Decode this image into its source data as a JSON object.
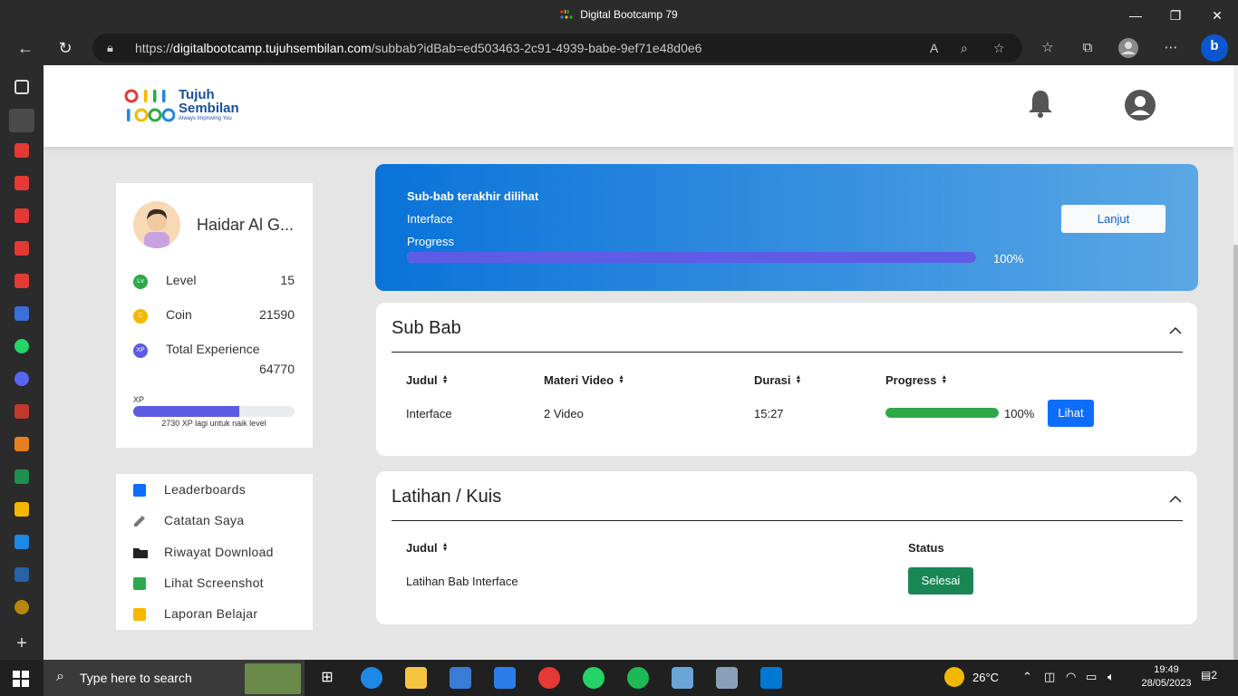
{
  "browser": {
    "window_title": "Digital Bootcamp 79",
    "url_prefix": "https://",
    "url_host": "digitalbootcamp.tujuhsembilan.com",
    "url_path": "/subbab?idBab=ed503463-2c91-4939-babe-9ef71e48d0e6"
  },
  "site": {
    "logo_word1": "Tujuh",
    "logo_word2": "Sembilan",
    "logo_tagline": "Always Improving You"
  },
  "profile": {
    "name": "Haidar Al G...",
    "stats": [
      {
        "badge": "Lv",
        "label": "Level",
        "value": "15",
        "color": "#2ea94a"
      },
      {
        "badge": "C",
        "label": "Coin",
        "value": "21590",
        "color": "#f5b800"
      },
      {
        "badge": "XP",
        "label": "Total Experience",
        "value": "64770",
        "color": "#5b5ce2"
      }
    ],
    "xp_label": "XP",
    "xp_fill_fraction": 0.66,
    "xp_note": "2730 XP lagi untuk naik level"
  },
  "menu": [
    {
      "label": "Leaderboards",
      "icon": "bar-chart-icon",
      "color": "#0d6efd"
    },
    {
      "label": "Catatan Saya",
      "icon": "pencil-icon",
      "color": "#777777"
    },
    {
      "label": "Riwayat Download",
      "icon": "folder-icon",
      "color": "#222222"
    },
    {
      "label": "Lihat Screenshot",
      "icon": "camera-icon",
      "color": "#2ea94a"
    },
    {
      "label": "Laporan Belajar",
      "icon": "clipboard-icon",
      "color": "#f5b800"
    }
  ],
  "banner": {
    "heading": "Sub-bab terakhir dilihat",
    "subbab": "Interface",
    "progress_label": "Progress",
    "progress_fraction": 1.0,
    "progress_text": "100%",
    "button": "Lanjut"
  },
  "subbab_section": {
    "title": "Sub Bab",
    "columns": [
      "Judul",
      "Materi Video",
      "Durasi",
      "Progress"
    ],
    "rows": [
      {
        "judul": "Interface",
        "materi": "2 Video",
        "durasi": "15:27",
        "progress_fraction": 1.0,
        "progress_text": "100%",
        "action": "Lihat"
      }
    ]
  },
  "kuis_section": {
    "title": "Latihan / Kuis",
    "columns": [
      "Judul",
      "Status"
    ],
    "rows": [
      {
        "judul": "Latihan Bab Interface",
        "status": "Selesai"
      }
    ]
  },
  "taskbar": {
    "search_placeholder": "Type here to search",
    "temperature": "26°C",
    "time": "19:49",
    "date": "28/05/2023",
    "notifications": "2"
  }
}
